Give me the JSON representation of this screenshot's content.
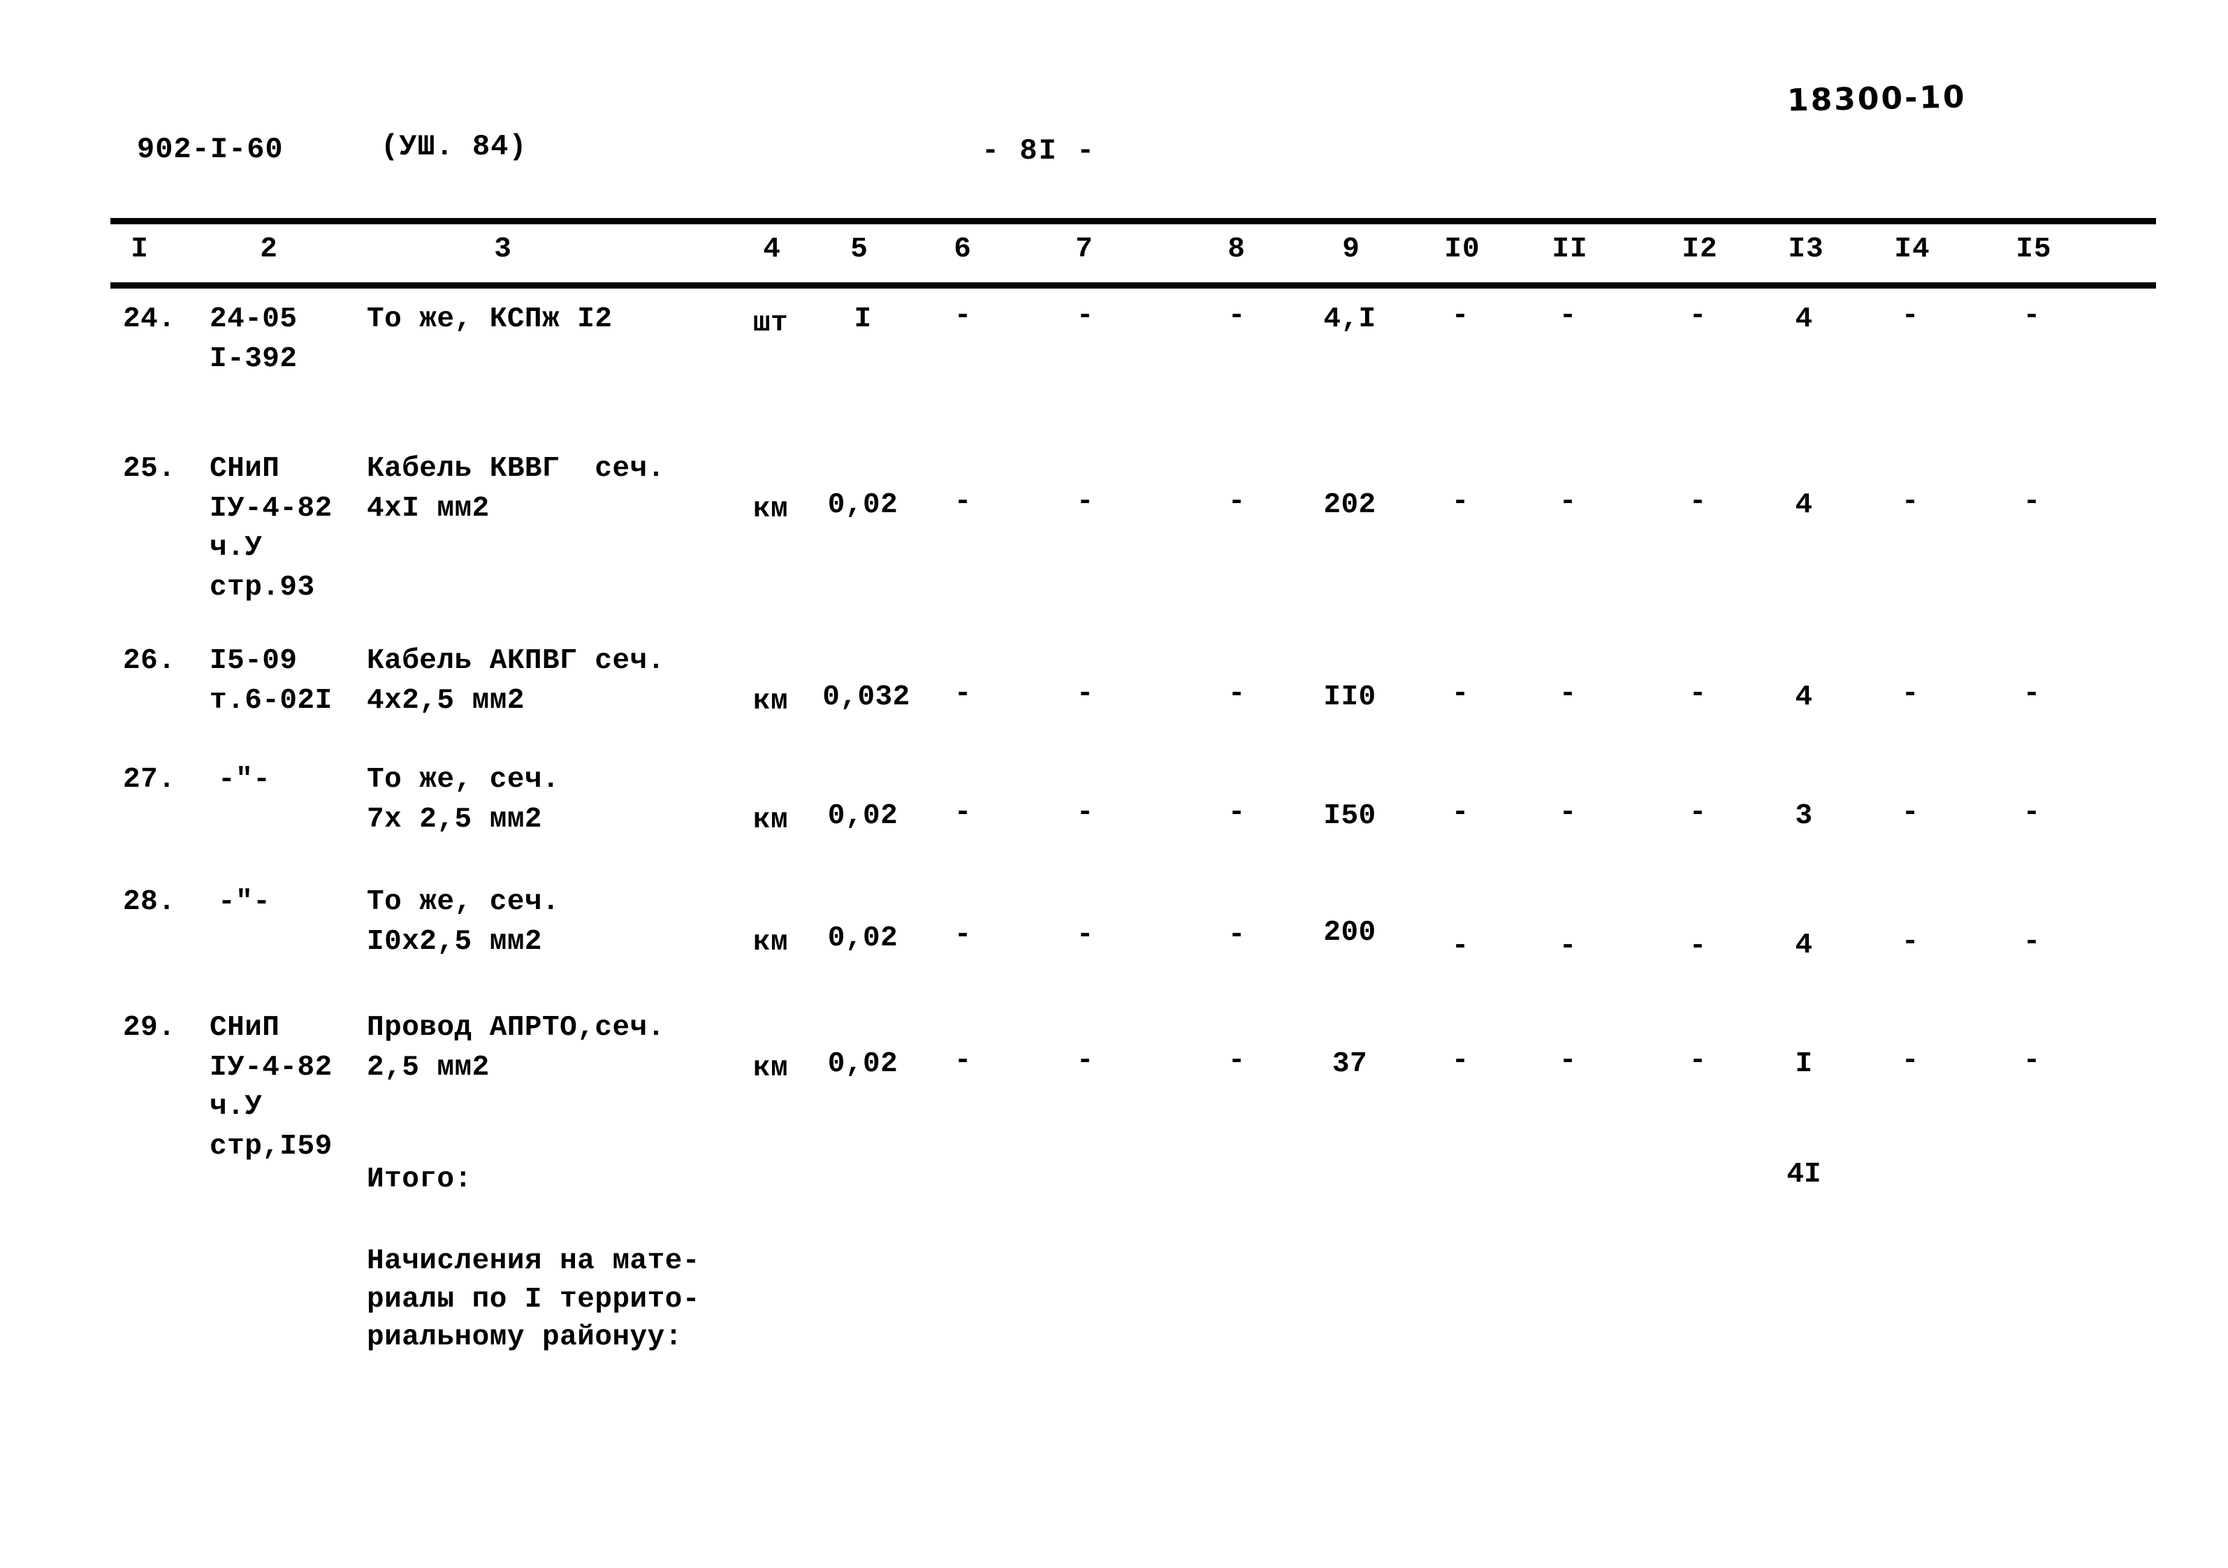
{
  "header": {
    "doc_code": "902-I-60",
    "revision": "(УШ. 84)",
    "page_number": "- 8I -",
    "stamp_code": "18300-10"
  },
  "table": {
    "column_headers": [
      "I",
      "2",
      "3",
      "4",
      "5",
      "6",
      "7",
      "8",
      "9",
      "I0",
      "II",
      "I2",
      "I3",
      "I4",
      "I5"
    ],
    "rows": [
      {
        "num": "24.",
        "code": "24-05\nI-392",
        "name": "То же, КСПж I2",
        "unit": "шт",
        "c5": "I",
        "c6": "-",
        "c7": "-",
        "c8": "-",
        "c9": "4,I",
        "c10": "-",
        "c11": "-",
        "c12": "-",
        "c13": "4",
        "c14": "-",
        "c15": "-"
      },
      {
        "num": "25.",
        "code": "СНиП\nIУ-4-82\nч.У\nстр.93",
        "name": "Кабель КВВГ  сеч.\n4xI мм2",
        "unit": "км",
        "c5": "0,02",
        "c6": "-",
        "c7": "-",
        "c8": "-",
        "c9": "202",
        "c10": "-",
        "c11": "-",
        "c12": "-",
        "c13": "4",
        "c14": "-",
        "c15": "-"
      },
      {
        "num": "26.",
        "code": "I5-09\nт.6-02I",
        "name": "Кабель АКПВГ сеч.\n4x2,5 мм2",
        "unit": "км",
        "c5": "0,032",
        "c6": "-",
        "c7": "-",
        "c8": "-",
        "c9": "II0",
        "c10": "-",
        "c11": "-",
        "c12": "-",
        "c13": "4",
        "c14": "-",
        "c15": "-"
      },
      {
        "num": "27.",
        "code": "-\"-",
        "name": "То же, сеч.\n7x 2,5 мм2",
        "unit": "км",
        "c5": "0,02",
        "c6": "-",
        "c7": "-",
        "c8": "-",
        "c9": "I50",
        "c10": "-",
        "c11": "-",
        "c12": "-",
        "c13": "3",
        "c14": "-",
        "c15": "-"
      },
      {
        "num": "28.",
        "code": "-\"-",
        "name": "То же, сеч.\nI0x2,5 мм2",
        "unit": "км",
        "c5": "0,02",
        "c6": "-",
        "c7": "-",
        "c8": "-",
        "c9": "200",
        "c10": "-",
        "c11": "-",
        "c12": "-",
        "c13": "4",
        "c14": "-",
        "c15": "-"
      },
      {
        "num": "29.",
        "code": "СНиП\nIУ-4-82\nч.У\nстр,I59",
        "name": "Провод АПРТО,сеч.\n2,5 мм2",
        "unit": "км",
        "c5": "0,02",
        "c6": "-",
        "c7": "-",
        "c8": "-",
        "c9": "37",
        "c10": "-",
        "c11": "-",
        "c12": "-",
        "c13": "I",
        "c14": "-",
        "c15": "-"
      }
    ],
    "total": {
      "label": "Итого:",
      "value": "4I"
    },
    "note": "Начисления на мате-\nриалы по I террито-\nриальному районуу:"
  }
}
